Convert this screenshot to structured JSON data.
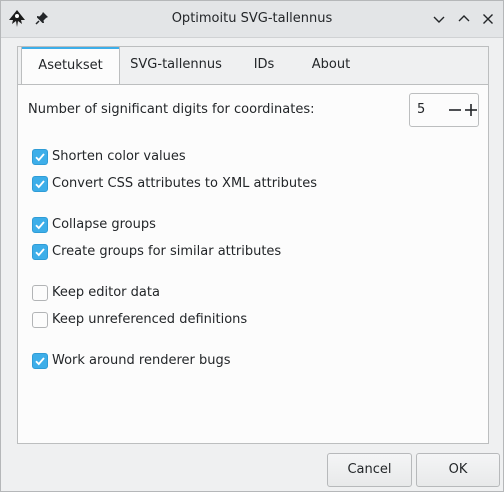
{
  "window": {
    "title": "Optimoitu SVG-tallennus",
    "icons": {
      "app": "inkscape-icon",
      "pin": "pin-icon",
      "minimize": "chevron-down-icon",
      "maximize": "chevron-up-icon",
      "close": "close-icon"
    }
  },
  "tabs": [
    {
      "label": "Asetukset",
      "active": true
    },
    {
      "label": "SVG-tallennus",
      "active": false
    },
    {
      "label": "IDs",
      "active": false
    },
    {
      "label": "About",
      "active": false
    }
  ],
  "settings": {
    "digits_label": "Number of significant digits for coordinates:",
    "digits_value": "5",
    "options": [
      {
        "label": "Shorten color values",
        "checked": true
      },
      {
        "label": "Convert CSS attributes to XML attributes",
        "checked": true
      },
      {
        "label": "Collapse groups",
        "checked": true
      },
      {
        "label": "Create groups for similar attributes",
        "checked": true
      },
      {
        "label": "Keep editor data",
        "checked": false
      },
      {
        "label": "Keep unreferenced definitions",
        "checked": false
      },
      {
        "label": "Work around renderer bugs",
        "checked": true
      }
    ]
  },
  "buttons": {
    "cancel": "Cancel",
    "ok": "OK"
  },
  "colors": {
    "accent": "#3daee9",
    "background": "#eff0f1",
    "panel": "#fcfcfc"
  }
}
